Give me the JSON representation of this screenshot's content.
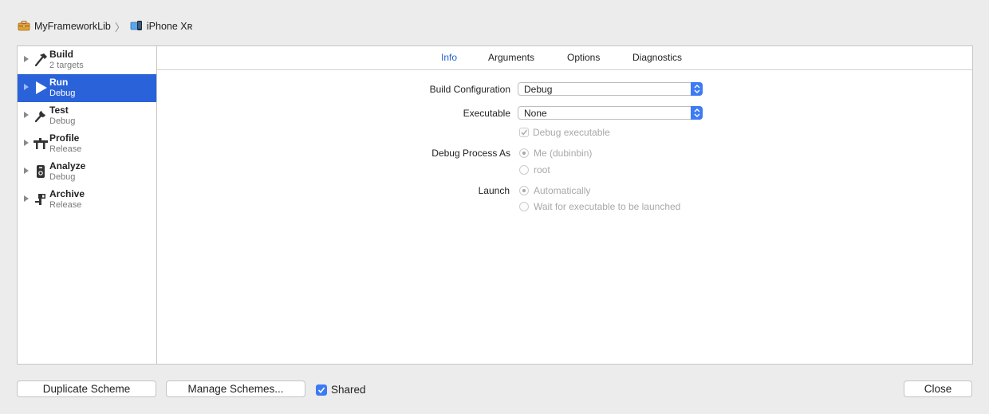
{
  "breadcrumb": {
    "project": "MyFrameworkLib",
    "separator": "〉",
    "device": "iPhone Xʀ"
  },
  "sidebar": {
    "items": [
      {
        "name": "Build",
        "sub": "2 targets",
        "icon": "hammer-icon"
      },
      {
        "name": "Run",
        "sub": "Debug",
        "icon": "play-icon",
        "selected": true
      },
      {
        "name": "Test",
        "sub": "Debug",
        "icon": "wrench-icon"
      },
      {
        "name": "Profile",
        "sub": "Release",
        "icon": "instruments-icon"
      },
      {
        "name": "Analyze",
        "sub": "Debug",
        "icon": "analyze-icon"
      },
      {
        "name": "Archive",
        "sub": "Release",
        "icon": "archive-icon"
      }
    ]
  },
  "tabs": {
    "info": "Info",
    "arguments": "Arguments",
    "options": "Options",
    "diagnostics": "Diagnostics",
    "active": "Info"
  },
  "form": {
    "build_configuration_label": "Build Configuration",
    "build_configuration_value": "Debug",
    "executable_label": "Executable",
    "executable_value": "None",
    "debug_executable_label": "Debug executable",
    "debug_process_as_label": "Debug Process As",
    "debug_process_me": "Me (dubinbin)",
    "debug_process_root": "root",
    "launch_label": "Launch",
    "launch_automatically": "Automatically",
    "launch_wait": "Wait for executable to be launched"
  },
  "footer": {
    "duplicate_scheme": "Duplicate Scheme",
    "manage_schemes": "Manage Schemes...",
    "shared_label": "Shared",
    "shared_checked": true,
    "close": "Close"
  },
  "colors": {
    "accent": "#3d7bf5",
    "selection": "#2a63d9",
    "active_tab": "#2a62d3"
  }
}
